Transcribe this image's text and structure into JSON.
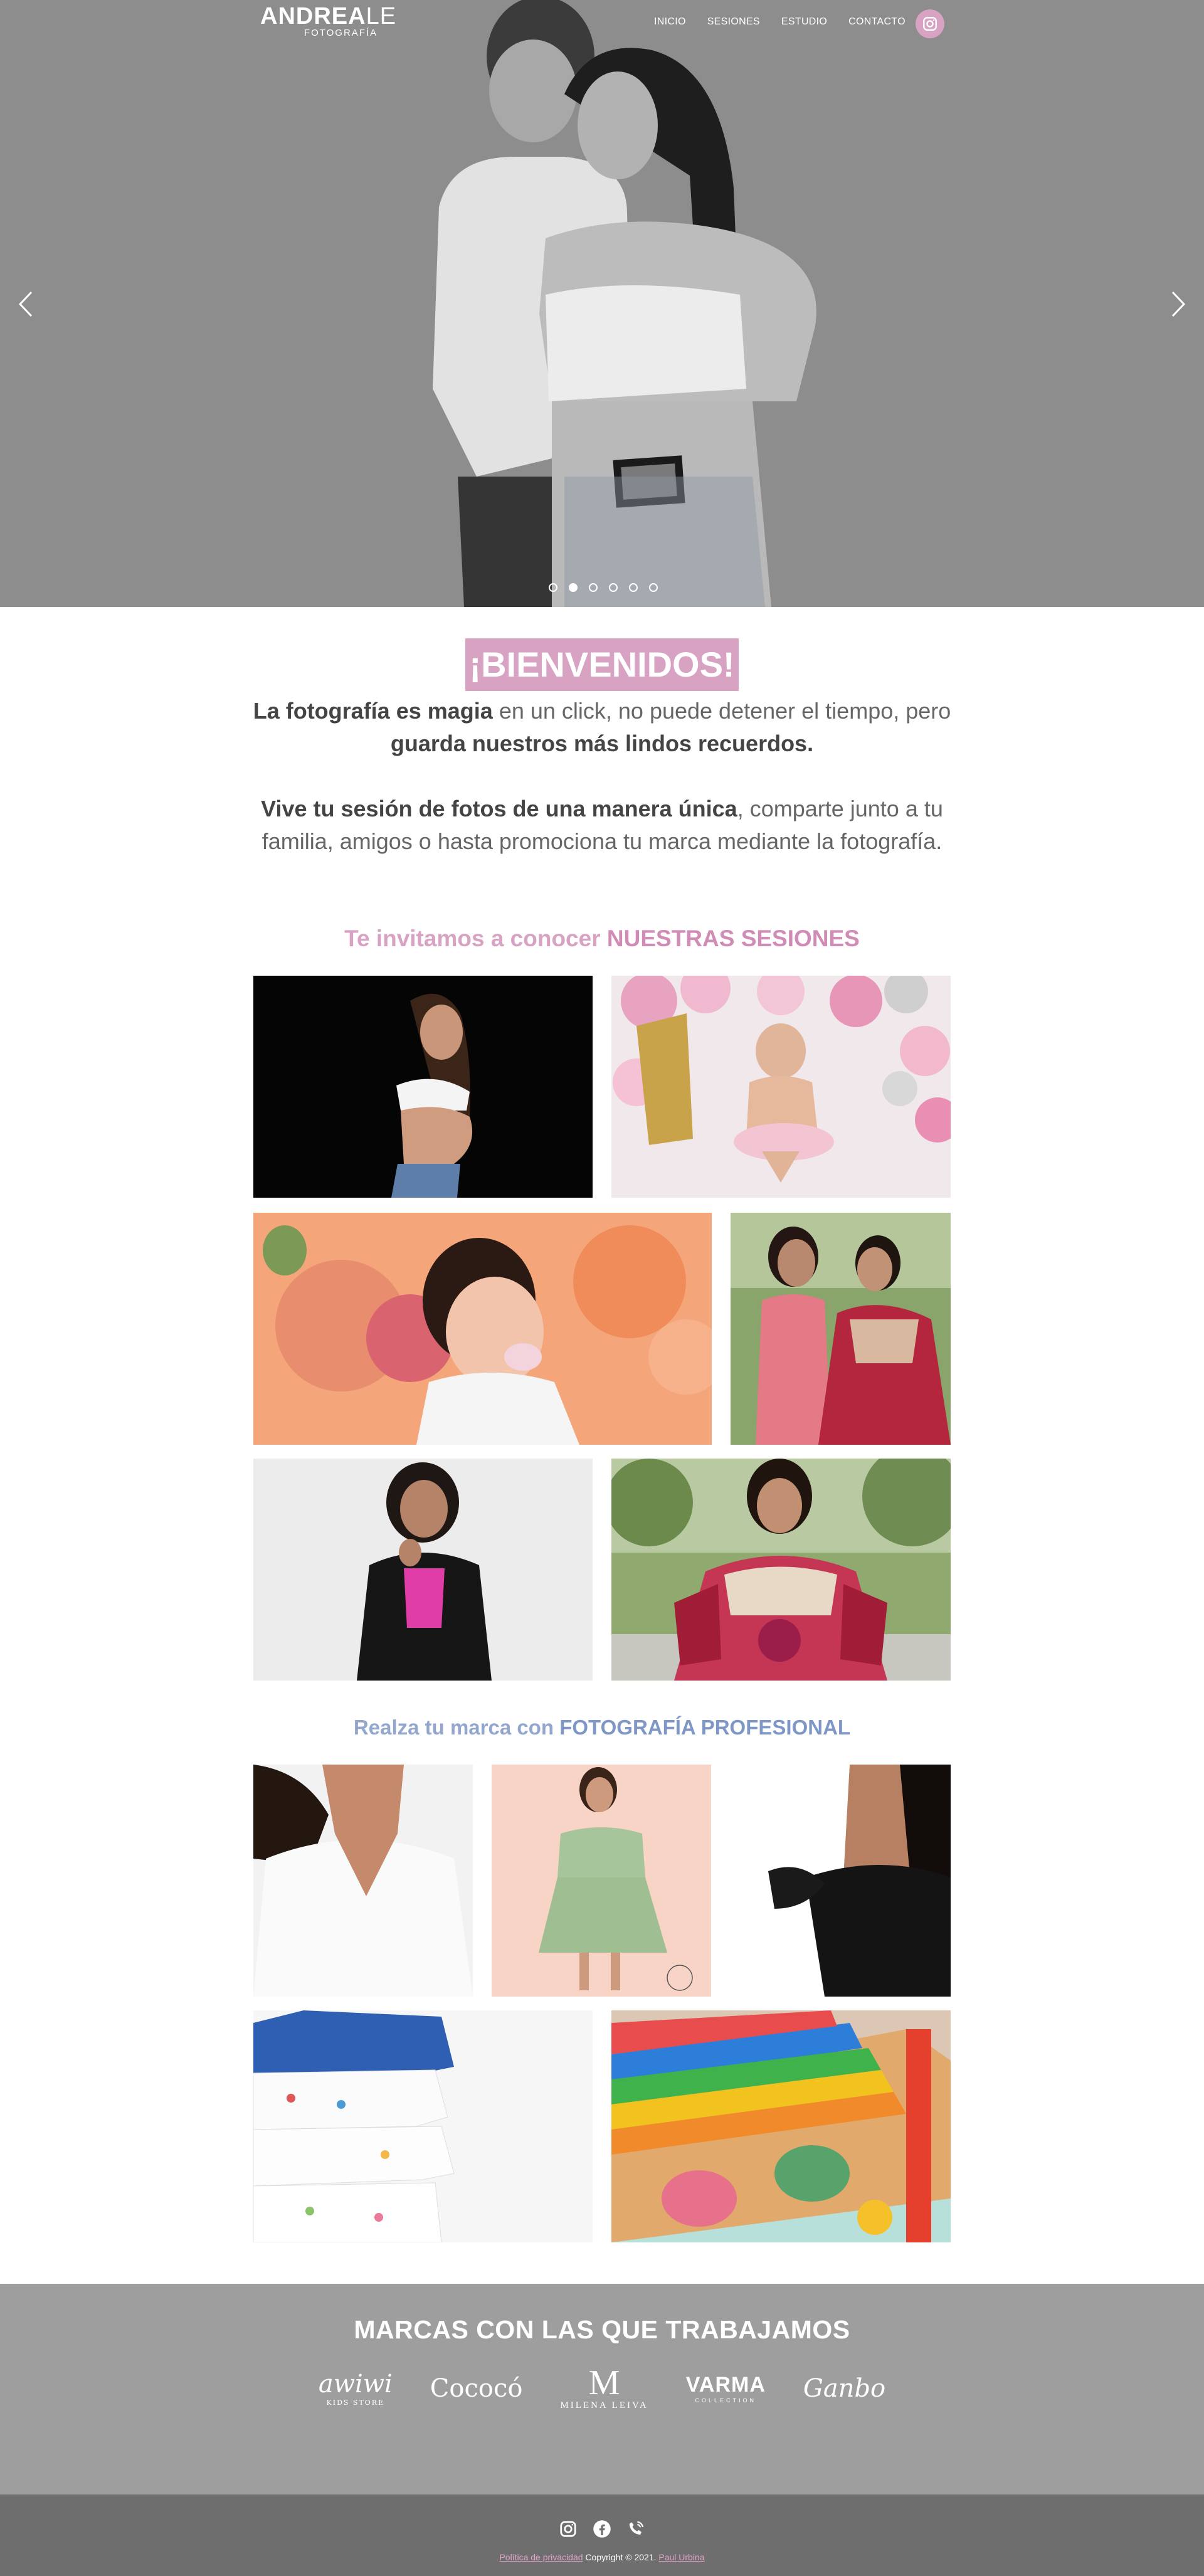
{
  "nav": {
    "logo_bold": "ANDREA",
    "logo_thin": "LE",
    "logo_sub": "FOTOGRAFÍA",
    "items": [
      {
        "label": "INICIO"
      },
      {
        "label": "SESIONES"
      },
      {
        "label": "ESTUDIO"
      },
      {
        "label": "CONTACTO"
      }
    ],
    "instagram_icon": "instagram-icon"
  },
  "hero": {
    "slide_count": 6,
    "active_slide": 2,
    "prev_icon": "chevron-left-icon",
    "next_icon": "chevron-right-icon"
  },
  "welcome": {
    "title": "¡BIENVENIDOS!",
    "p1_bold1": "La fotografía es magia",
    "p1_text1": " en un click, no puede detener el tiempo, pero ",
    "p1_bold2": "guarda nuestros más lindos recuerdos.",
    "p2_bold": "Vive tu sesión de fotos de una manera única",
    "p2_text": ", comparte junto a tu familia, amigos o hasta promociona tu marca mediante la fotografía."
  },
  "sessions": {
    "heading_text": "Te invitamos a conocer ",
    "heading_bold": "NUESTRAS SESIONES"
  },
  "brand_section": {
    "heading_text": "Realza tu marca con ",
    "heading_bold": "FOTOGRAFÍA PROFESIONAL"
  },
  "brands": {
    "title": "MARCAS CON LAS QUE TRABAJAMOS",
    "logos": [
      {
        "name": "awiwi",
        "sub": "KIDS STORE"
      },
      {
        "name": "Cococó"
      },
      {
        "name": "MILENA LEIVA",
        "mark": "M"
      },
      {
        "name": "VARMA",
        "sub": "COLLECTION"
      },
      {
        "name": "Ganbo"
      }
    ]
  },
  "footer": {
    "privacy": "Política de privacidad",
    "copyright": " Copyright © 2021. ",
    "author": "Paul Urbina"
  },
  "colors": {
    "accent_pink": "#d8a2c3",
    "accent_blue": "#93a7ce",
    "hero_grey": "#8e8e8e",
    "brands_grey": "#9e9e9e",
    "footer_grey": "#6e6e6e"
  }
}
